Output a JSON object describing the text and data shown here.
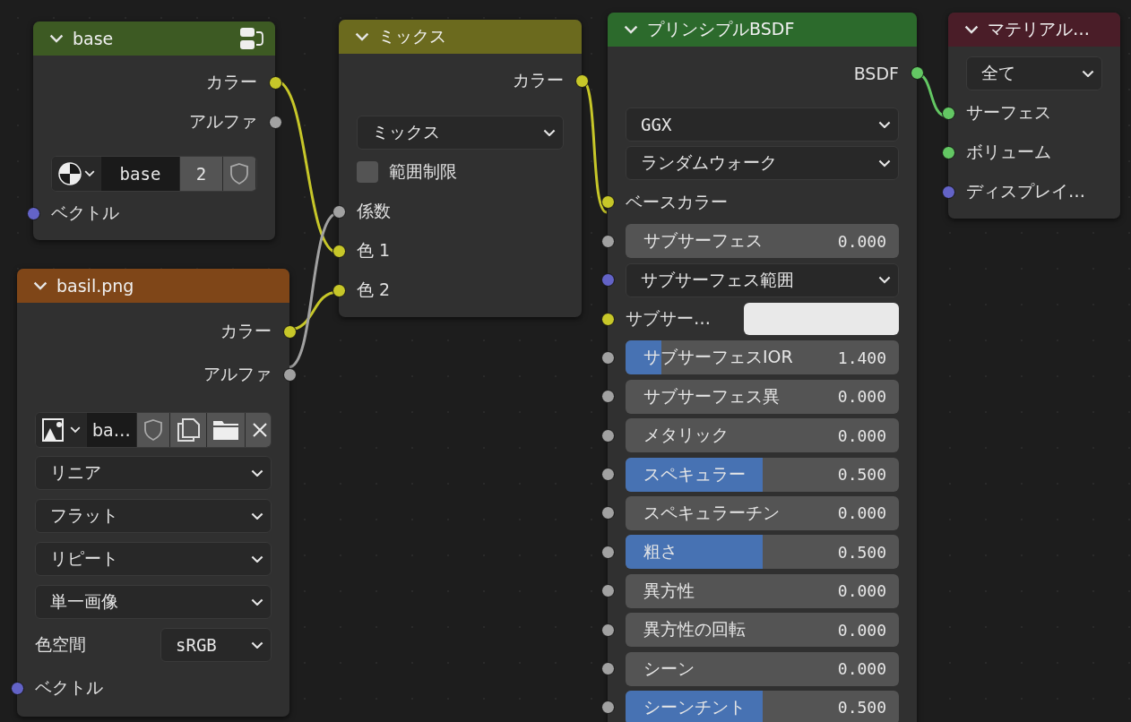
{
  "nodes": [
    {
      "title": "base",
      "kind": "group",
      "color": "#3d5a23",
      "rows": [
        {
          "kind": "output",
          "label": "カラー",
          "color": "#c7c729"
        },
        {
          "kind": "output",
          "label": "アルファ",
          "color": "#a1a1a1"
        },
        {
          "kind": "datablock",
          "name": "base",
          "count": "2"
        },
        {
          "kind": "input",
          "label": "ベクトル",
          "color": "#6363c7"
        }
      ]
    },
    {
      "title": "basil.png",
      "kind": "shader",
      "color": "#7f4618",
      "rows": [
        {
          "kind": "output",
          "label": "カラー",
          "color": "#c7c729"
        },
        {
          "kind": "output",
          "label": "アルファ",
          "color": "#a1a1a1"
        },
        {
          "kind": "image-datablock",
          "name": "ba…"
        },
        {
          "kind": "dropdown",
          "label": "リニア"
        },
        {
          "kind": "dropdown",
          "label": "フラット"
        },
        {
          "kind": "dropdown",
          "label": "リピート"
        },
        {
          "kind": "dropdown",
          "label": "単一画像"
        },
        {
          "kind": "property",
          "label": "色空間",
          "value": "sRGB"
        },
        {
          "kind": "input",
          "label": "ベクトル",
          "color": "#6363c7"
        }
      ]
    },
    {
      "title": "ミックス",
      "kind": "shader",
      "color": "#6b6a1e",
      "rows": [
        {
          "kind": "output",
          "label": "カラー",
          "color": "#c7c729"
        },
        {
          "kind": "dropdown",
          "label": "ミックス"
        },
        {
          "kind": "checkbox",
          "label": "範囲制限",
          "checked": false
        },
        {
          "kind": "input",
          "label": "係数",
          "color": "#a1a1a1"
        },
        {
          "kind": "input",
          "label": "色 1",
          "color": "#c7c729"
        },
        {
          "kind": "input",
          "label": "色 2",
          "color": "#c7c729"
        }
      ]
    },
    {
      "title": "プリンシプルBSDF",
      "kind": "shader",
      "color": "#2c6a2c",
      "rows": [
        {
          "kind": "output",
          "label": "BSDF",
          "color": "#63c763"
        },
        {
          "kind": "dropdown",
          "label": "GGX"
        },
        {
          "kind": "dropdown",
          "label": "ランダムウォーク"
        },
        {
          "kind": "input",
          "label": "ベースカラー",
          "color": "#c7c729"
        },
        {
          "kind": "slider",
          "label": "サブサーフェス",
          "value": "0.000",
          "level": 0,
          "color": "#a1a1a1"
        },
        {
          "kind": "dropdown",
          "label": "サブサーフェス範囲",
          "color": "#6363c7"
        },
        {
          "kind": "color",
          "label": "サブサー…",
          "color": "#c7c729"
        },
        {
          "kind": "slider",
          "label": "サブサーフェスIOR",
          "value": "1.400",
          "level": 0.13,
          "color": "#a1a1a1"
        },
        {
          "kind": "slider",
          "label": "サブサーフェス異",
          "value": "0.000",
          "level": 0,
          "color": "#a1a1a1"
        },
        {
          "kind": "slider",
          "label": "メタリック",
          "value": "0.000",
          "level": 0,
          "color": "#a1a1a1"
        },
        {
          "kind": "slider",
          "label": "スペキュラー",
          "value": "0.500",
          "level": 0.5,
          "color": "#a1a1a1"
        },
        {
          "kind": "slider",
          "label": "スペキュラーチン",
          "value": "0.000",
          "level": 0,
          "color": "#a1a1a1"
        },
        {
          "kind": "slider",
          "label": "粗さ",
          "value": "0.500",
          "level": 0.5,
          "color": "#a1a1a1"
        },
        {
          "kind": "slider",
          "label": "異方性",
          "value": "0.000",
          "level": 0,
          "color": "#a1a1a1"
        },
        {
          "kind": "slider",
          "label": "異方性の回転",
          "value": "0.000",
          "level": 0,
          "color": "#a1a1a1"
        },
        {
          "kind": "slider",
          "label": "シーン",
          "value": "0.000",
          "level": 0,
          "color": "#a1a1a1"
        },
        {
          "kind": "slider",
          "label": "シーンチント",
          "value": "0.500",
          "level": 0.5,
          "color": "#a1a1a1"
        }
      ]
    },
    {
      "title": "マテリアル…",
      "kind": "shader",
      "color": "#4a1d28",
      "rows": [
        {
          "kind": "dropdown",
          "label": "全て"
        },
        {
          "kind": "input",
          "label": "サーフェス",
          "color": "#63c763"
        },
        {
          "kind": "input",
          "label": "ボリューム",
          "color": "#63c763"
        },
        {
          "kind": "input",
          "label": "ディスプレイ…",
          "color": "#6363c7"
        }
      ]
    }
  ]
}
